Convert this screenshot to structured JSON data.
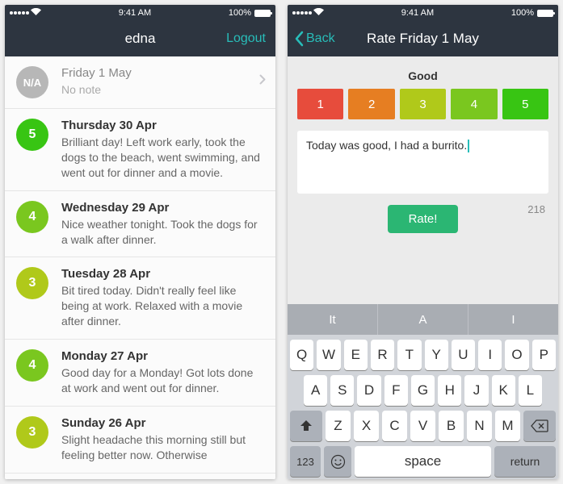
{
  "status": {
    "time": "9:41 AM",
    "battery_pct": "100%"
  },
  "left": {
    "nav": {
      "title": "edna",
      "logout": "Logout"
    },
    "entries": [
      {
        "badge": "N/A",
        "color": "#b7b7b7",
        "date": "Friday 1 May",
        "note": "No note",
        "muted": true,
        "chevron": true
      },
      {
        "badge": "5",
        "color": "#38c513",
        "date": "Thursday 30 Apr",
        "note": "Brilliant day! Left work early, took the dogs to the beach, went swimming, and went out for dinner and a movie."
      },
      {
        "badge": "4",
        "color": "#7ac71f",
        "date": "Wednesday 29 Apr",
        "note": "Nice weather tonight. Took the dogs for a walk after dinner."
      },
      {
        "badge": "3",
        "color": "#b0c91a",
        "date": "Tuesday 28 Apr",
        "note": "Bit tired today. Didn't really feel like being at work. Relaxed with a movie after dinner."
      },
      {
        "badge": "4",
        "color": "#7ac71f",
        "date": "Monday 27 Apr",
        "note": "Good day for a Monday! Got lots done at work and went out for dinner."
      },
      {
        "badge": "3",
        "color": "#b0c91a",
        "date": "Sunday 26 Apr",
        "note": "Slight headache this morning still but feeling better now. Otherwise"
      }
    ]
  },
  "right": {
    "nav": {
      "back": "Back",
      "title": "Rate Friday 1 May"
    },
    "rating_label": "Good",
    "ratings": [
      {
        "n": "1",
        "c": "#e74c3c"
      },
      {
        "n": "2",
        "c": "#e67e22"
      },
      {
        "n": "3",
        "c": "#b0c91a"
      },
      {
        "n": "4",
        "c": "#7ac71f"
      },
      {
        "n": "5",
        "c": "#38c513"
      }
    ],
    "note_text": "Today was good, I had a burrito.",
    "char_count": "218",
    "rate_btn": "Rate!",
    "keyboard": {
      "suggestions": [
        "It",
        "A",
        "I"
      ],
      "rows": [
        [
          "Q",
          "W",
          "E",
          "R",
          "T",
          "Y",
          "U",
          "I",
          "O",
          "P"
        ],
        [
          "A",
          "S",
          "D",
          "F",
          "G",
          "H",
          "J",
          "K",
          "L"
        ],
        [
          "Z",
          "X",
          "C",
          "V",
          "B",
          "N",
          "M"
        ]
      ],
      "key_123": "123",
      "key_space": "space",
      "key_return": "return"
    }
  }
}
